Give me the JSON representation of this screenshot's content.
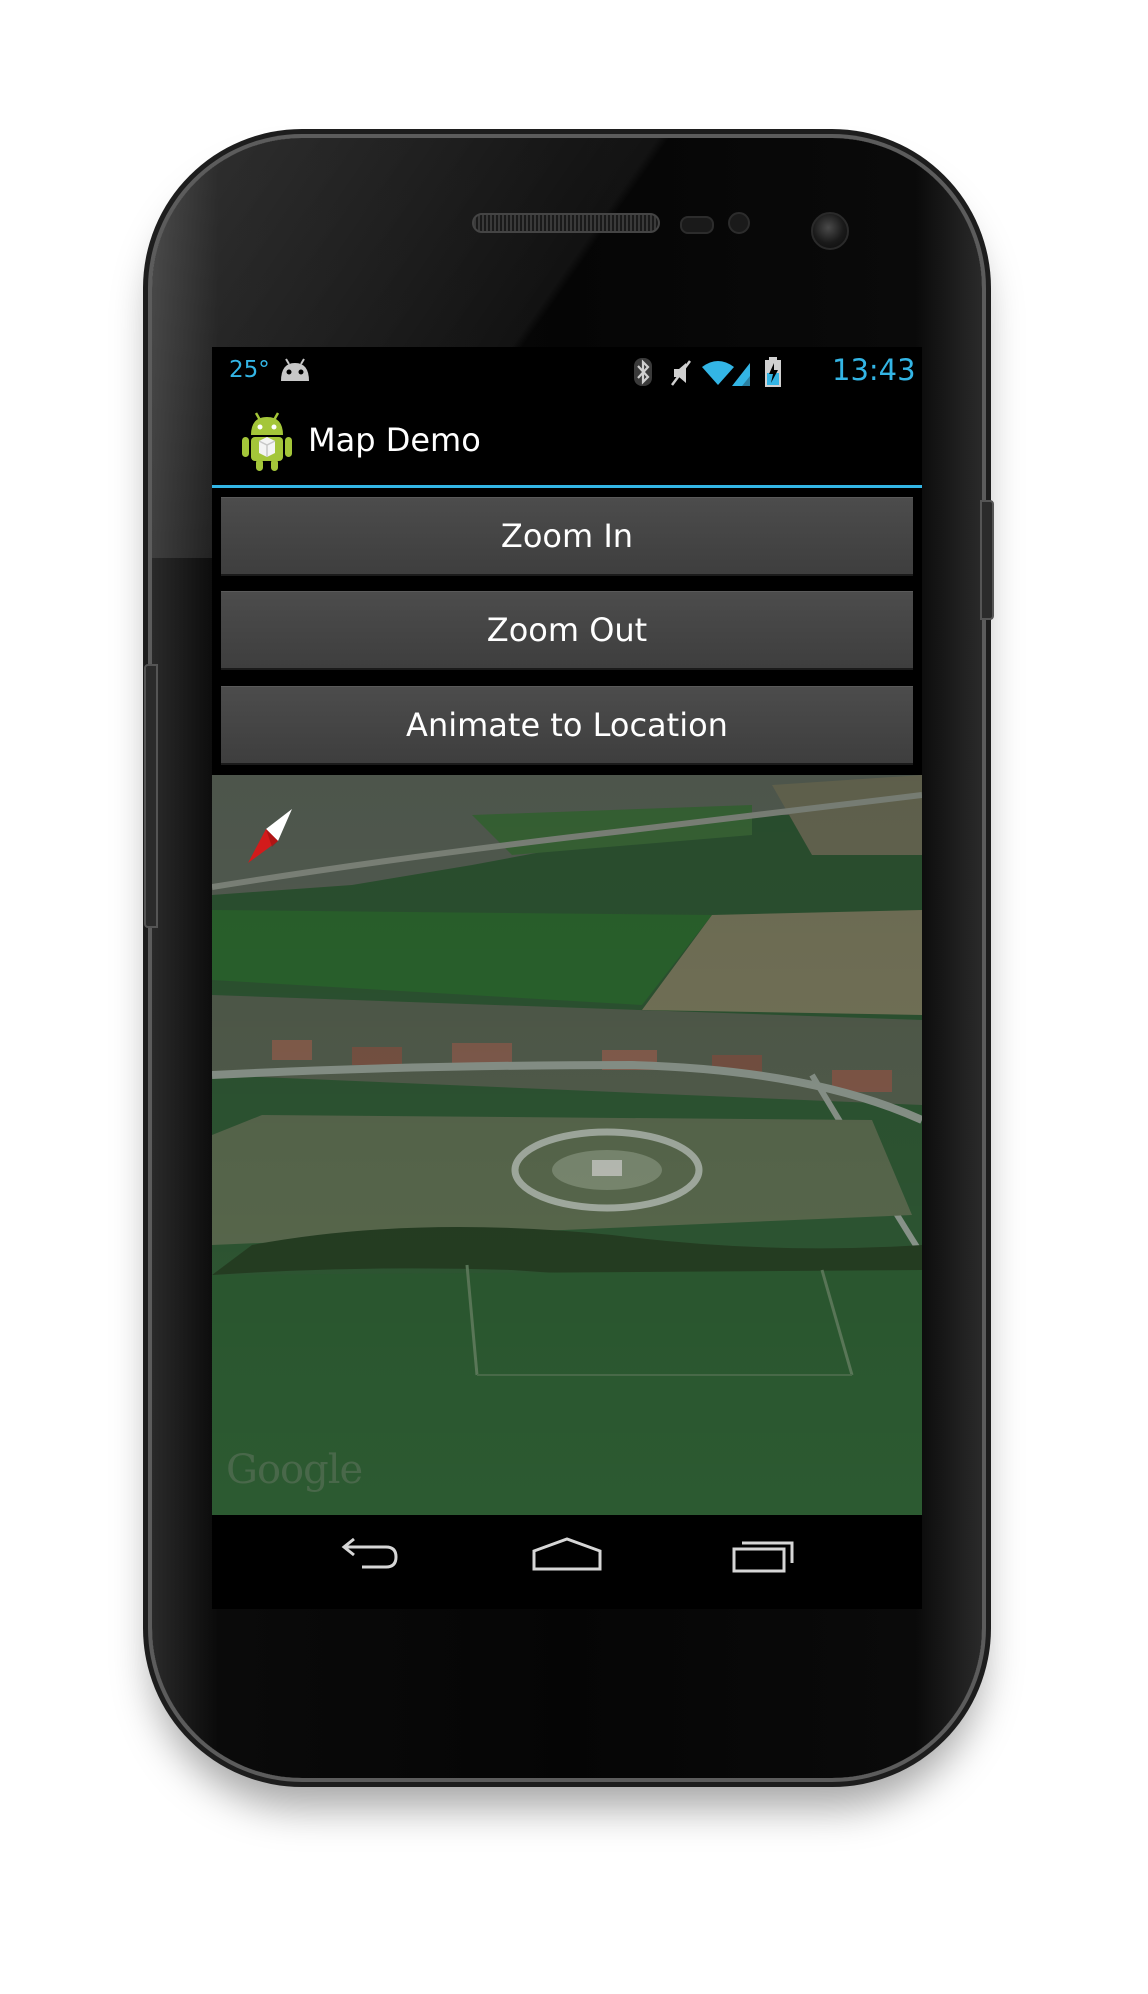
{
  "status_bar": {
    "temperature": "25°",
    "time": "13:43",
    "icons": [
      "android-notification-icon",
      "bluetooth-icon",
      "mute-icon",
      "wifi-icon",
      "signal-icon",
      "battery-charging-icon"
    ]
  },
  "action_bar": {
    "app_icon": "android-robot-icon",
    "title": "Map Demo"
  },
  "buttons": {
    "zoom_in": "Zoom In",
    "zoom_out": "Zoom Out",
    "animate": "Animate to Location"
  },
  "map": {
    "attribution": "Google",
    "compass_icon": "compass-icon"
  },
  "nav_bar": {
    "icons": [
      "back-icon",
      "home-icon",
      "recent-apps-icon"
    ]
  },
  "colors": {
    "accent": "#33b5e5",
    "button_bg": "#444444",
    "map_green": "#2f5533"
  }
}
